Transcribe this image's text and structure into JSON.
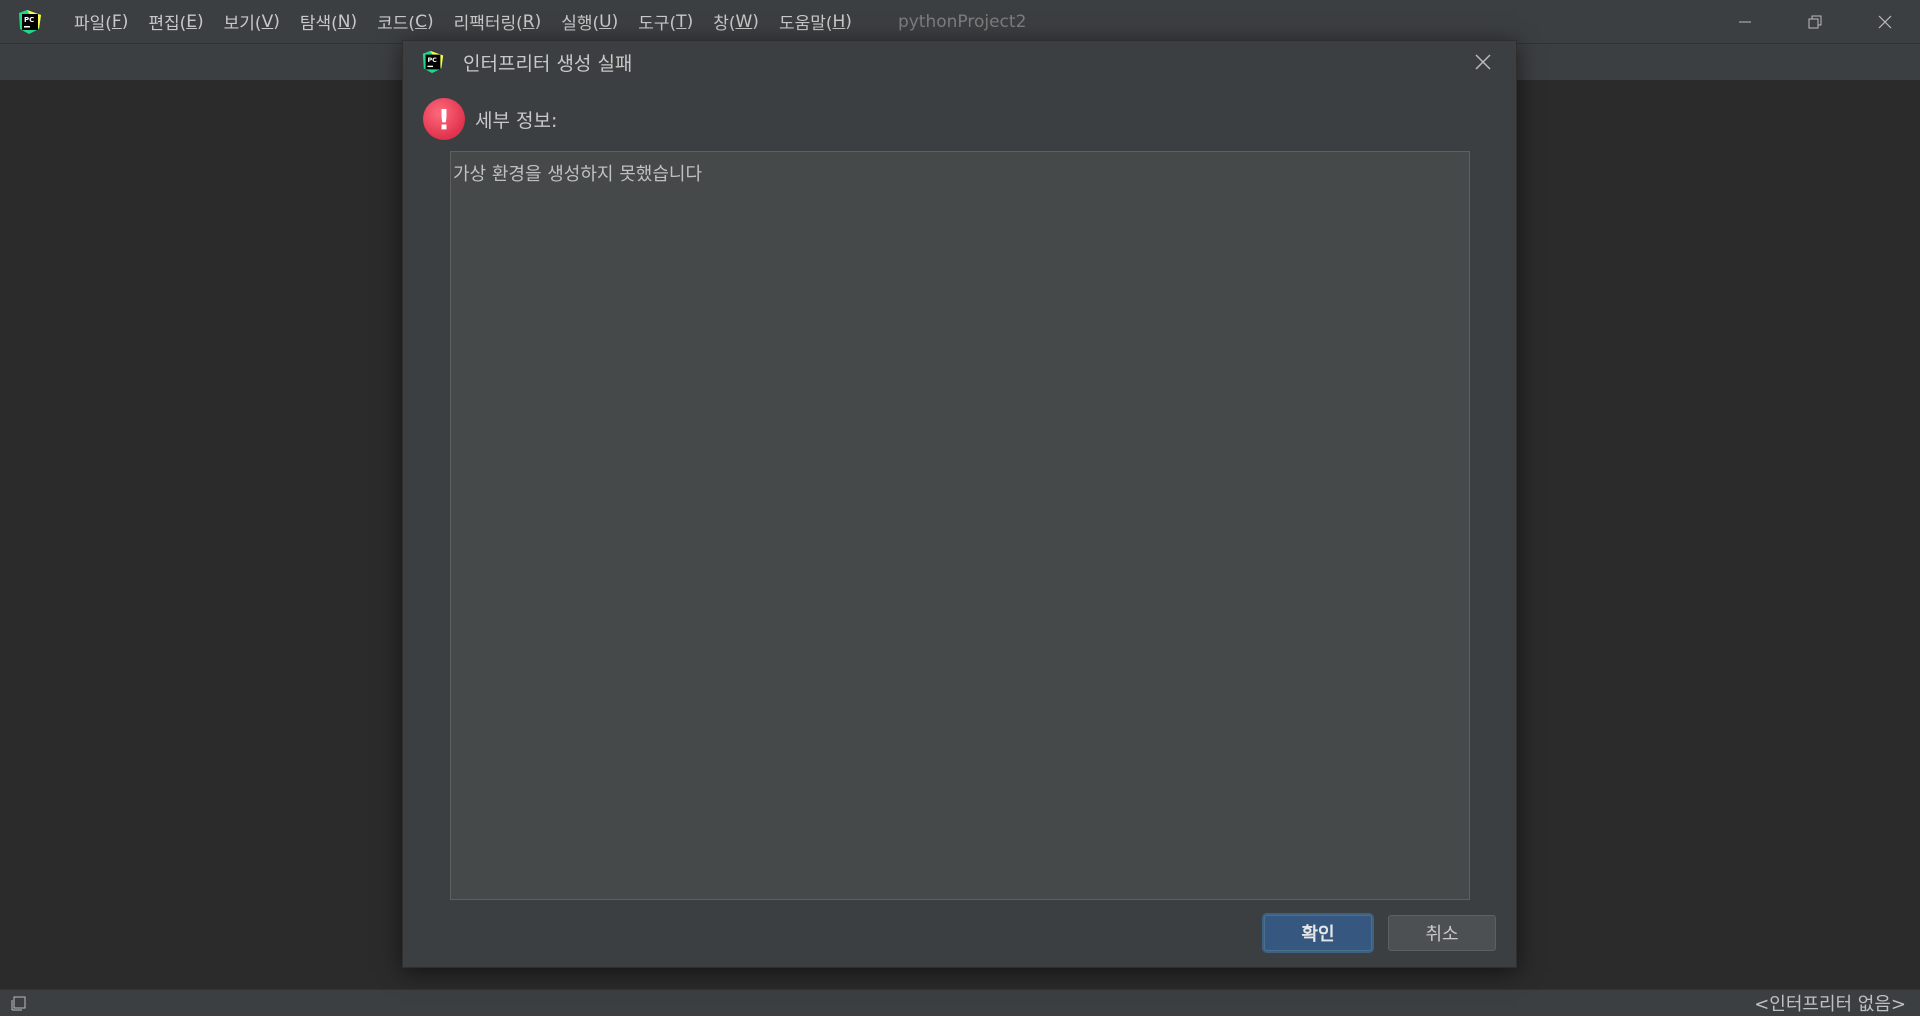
{
  "menu": {
    "items": [
      {
        "label": "파일(",
        "mnemonic": "F",
        "close": ")"
      },
      {
        "label": "편집(",
        "mnemonic": "E",
        "close": ")"
      },
      {
        "label": "보기(",
        "mnemonic": "V",
        "close": ")"
      },
      {
        "label": "탐색(",
        "mnemonic": "N",
        "close": ")"
      },
      {
        "label": "코드(",
        "mnemonic": "C",
        "close": ")"
      },
      {
        "label": "리팩터링(",
        "mnemonic": "R",
        "close": ")"
      },
      {
        "label": "실행(",
        "mnemonic": "U",
        "close": ")"
      },
      {
        "label": "도구(",
        "mnemonic": "T",
        "close": ")"
      },
      {
        "label": "창(",
        "mnemonic": "W",
        "close": ")"
      },
      {
        "label": "도움말(",
        "mnemonic": "H",
        "close": ")"
      }
    ],
    "project_name": "pythonProject2"
  },
  "dialog": {
    "title": "인터프리터 생성 실패",
    "detail_label": "세부 정보:",
    "detail_text": "가상 환경을 생성하지 못했습니다",
    "ok_label": "확인",
    "cancel_label": "취소",
    "icon": "error-icon"
  },
  "statusbar": {
    "interpreter": "<인터프리터 없음>"
  },
  "colors": {
    "background": "#2b2b2b",
    "panel": "#3c3f41",
    "accent_button": "#365880",
    "error": "#e0334d"
  }
}
